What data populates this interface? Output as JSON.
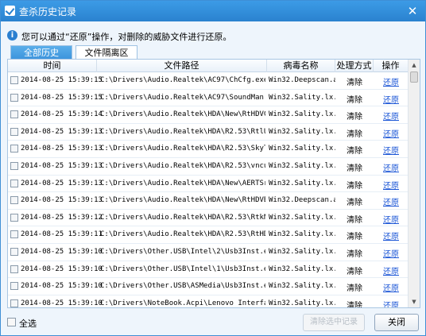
{
  "window": {
    "title": "查杀历史记录",
    "close_glyph": "✕"
  },
  "info": {
    "icon_glyph": "i",
    "message": "您可以通过“还原”操作，对删除的威胁文件进行还原。"
  },
  "tabs": [
    {
      "label": "全部历史"
    },
    {
      "label": "文件隔离区"
    }
  ],
  "table": {
    "columns": [
      "时间",
      "文件路径",
      "病毒名称",
      "处理方式",
      "操作"
    ],
    "rows": [
      {
        "time": "2014-08-25 15:39:15",
        "path": "C:\\Drivers\\Audio.Realtek\\AC97\\ChCfg.exe",
        "virus": "Win32.Deepscan.a",
        "method": "清除",
        "action": "还原"
      },
      {
        "time": "2014-08-25 15:39:15",
        "path": "C:\\Drivers\\Audio.Realtek\\AC97\\SoundMan.exe",
        "virus": "Win32.Sality.lx...",
        "method": "清除",
        "action": "还原"
      },
      {
        "time": "2014-08-25 15:39:14",
        "path": "C:\\Drivers\\Audio.Realtek\\HDA\\New\\RtHDVCpl...",
        "virus": "Win32.Sality.lx...",
        "method": "清除",
        "action": "还原"
      },
      {
        "time": "2014-08-25 15:39:13",
        "path": "C:\\Drivers\\Audio.Realtek\\HDA\\R2.53\\RtlUpd...",
        "virus": "Win32.Sality.lx...",
        "method": "清除",
        "action": "还原"
      },
      {
        "time": "2014-08-25 15:39:13",
        "path": "C:\\Drivers\\Audio.Realtek\\HDA\\R2.53\\SkyTel...",
        "virus": "Win32.Sality.lx...",
        "method": "清除",
        "action": "还原"
      },
      {
        "time": "2014-08-25 15:39:13",
        "path": "C:\\Drivers\\Audio.Realtek\\HDA\\R2.53\\vncuti...",
        "virus": "Win32.Sality.lx...",
        "method": "清除",
        "action": "还原"
      },
      {
        "time": "2014-08-25 15:39:13",
        "path": "C:\\Drivers\\Audio.Realtek\\HDA\\New\\AERTSrv.exe",
        "virus": "Win32.Sality.lx...",
        "method": "清除",
        "action": "还原"
      },
      {
        "time": "2014-08-25 15:39:13",
        "path": "C:\\Drivers\\Audio.Realtek\\HDA\\New\\RtHDVBg.exe",
        "virus": "Win32.Deepscan.a",
        "method": "清除",
        "action": "还原"
      },
      {
        "time": "2014-08-25 15:39:12",
        "path": "C:\\Drivers\\Audio.Realtek\\HDA\\R2.53\\RtkNGU...",
        "virus": "Win32.Sality.lx...",
        "method": "清除",
        "action": "还原"
      },
      {
        "time": "2014-08-25 15:39:11",
        "path": "C:\\Drivers\\Audio.Realtek\\HDA\\R2.53\\RtHDVC...",
        "virus": "Win32.Sality.lx...",
        "method": "清除",
        "action": "还原"
      },
      {
        "time": "2014-08-25 15:39:10",
        "path": "C:\\Drivers\\Other.USB\\Intel\\2\\Usb3Inst.exe",
        "virus": "Win32.Sality.lx...",
        "method": "清除",
        "action": "还原"
      },
      {
        "time": "2014-08-25 15:39:10",
        "path": "C:\\Drivers\\Other.USB\\Intel\\1\\Usb3Inst.exe",
        "virus": "Win32.Sality.lx...",
        "method": "清除",
        "action": "还原"
      },
      {
        "time": "2014-08-25 15:39:10",
        "path": "C:\\Drivers\\Other.USB\\ASMedia\\Usb3Inst.exe",
        "virus": "Win32.Sality.lx...",
        "method": "清除",
        "action": "还原"
      },
      {
        "time": "2014-08-25 15:39:10",
        "path": "C:\\Drivers\\NoteBook.Acpi\\Lenovo Interface...",
        "virus": "Win32.Sality.lx...",
        "method": "清除",
        "action": "还原"
      }
    ]
  },
  "scrollbar": {
    "up_glyph": "▲",
    "down_glyph": "▼"
  },
  "footer": {
    "select_all": "全选",
    "clear_selected": "清除选中记录",
    "close": "关闭"
  }
}
